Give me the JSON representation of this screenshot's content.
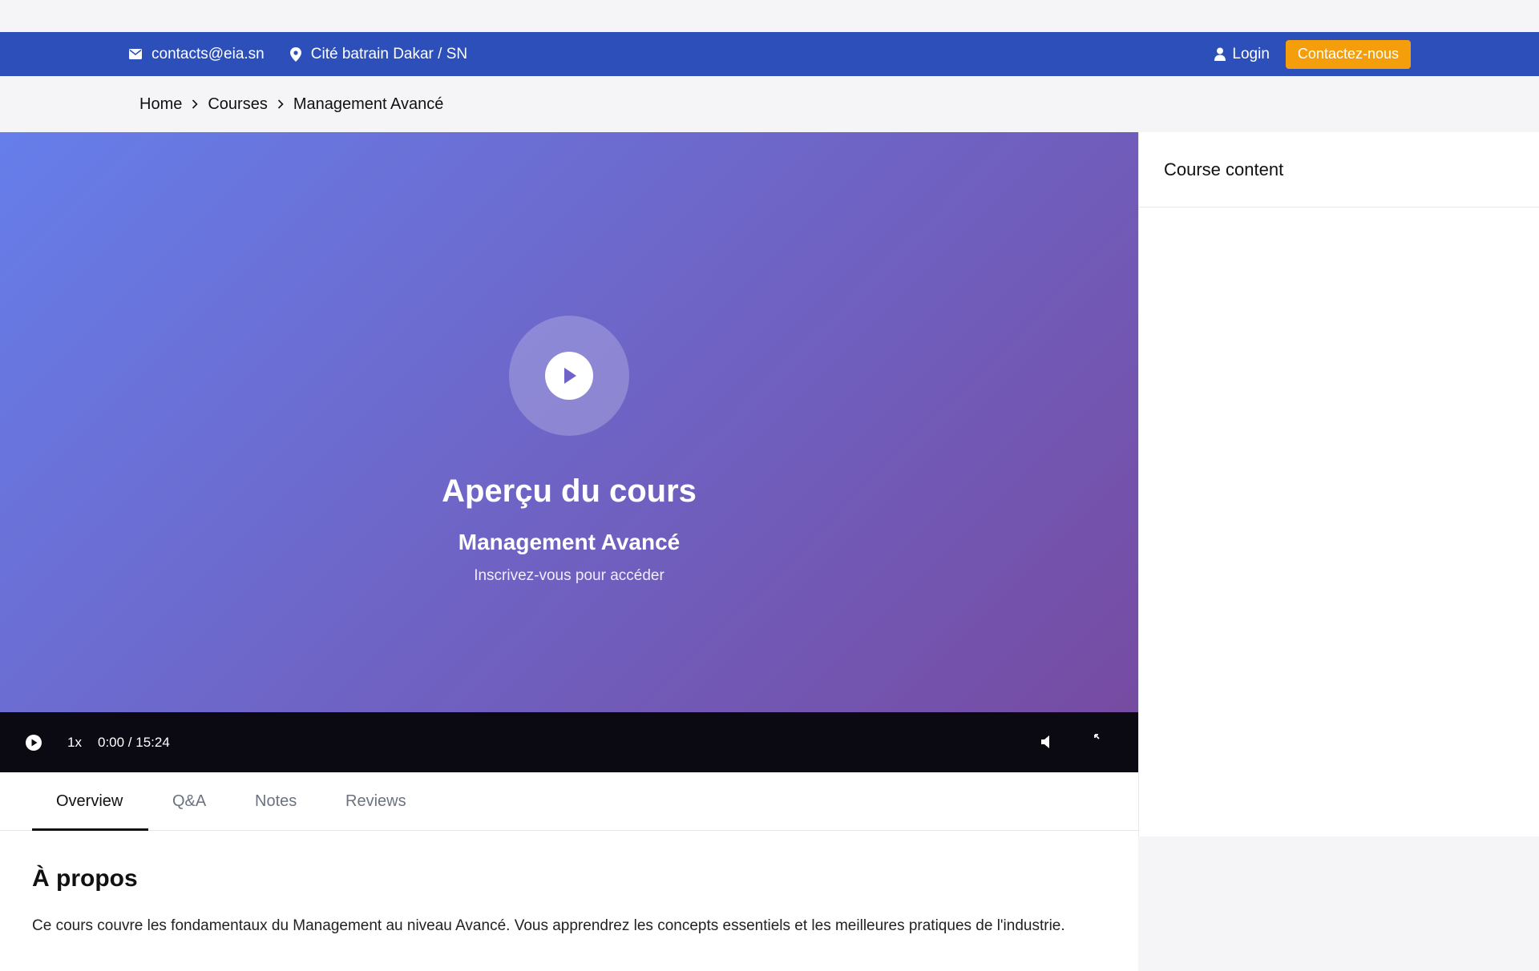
{
  "topbar": {
    "email": "contacts@eia.sn",
    "location": "Cité batrain Dakar / SN",
    "login_label": "Login",
    "contact_label": "Contactez-nous"
  },
  "breadcrumb": {
    "items": [
      "Home",
      "Courses",
      "Management Avancé"
    ]
  },
  "player": {
    "title": "Aperçu du cours",
    "course_name": "Management Avancé",
    "subtitle": "Inscrivez-vous pour accéder",
    "speed": "1x",
    "time": "0:00 / 15:24"
  },
  "tabs": [
    {
      "label": "Overview",
      "active": true
    },
    {
      "label": "Q&A",
      "active": false
    },
    {
      "label": "Notes",
      "active": false
    },
    {
      "label": "Reviews",
      "active": false
    }
  ],
  "about": {
    "heading": "À propos",
    "text": "Ce cours couvre les fondamentaux du Management au niveau Avancé. Vous apprendrez les concepts essentiels et les meilleures pratiques de l'industrie."
  },
  "sidebar": {
    "title": "Course content"
  },
  "colors": {
    "topbar_bg": "#2d4fb9",
    "accent_button": "#f59e0b",
    "player_gradient_start": "#667eea",
    "player_gradient_end": "#764ba2",
    "controls_bg": "#0b0a12"
  },
  "icons": [
    "mail-icon",
    "map-pin-icon",
    "user-icon",
    "chevron-right-icon",
    "play-icon",
    "volume-icon",
    "fullscreen-exit-icon"
  ]
}
